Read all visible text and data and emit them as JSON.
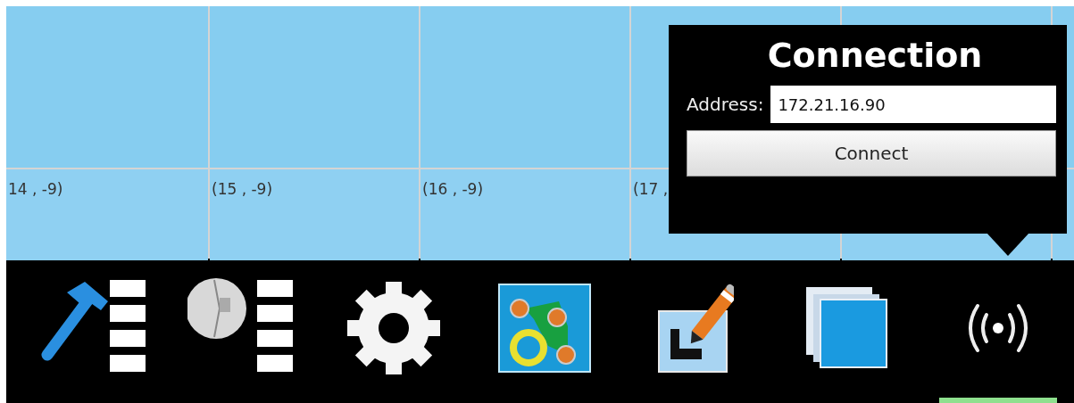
{
  "grid": {
    "labels": [
      "14 , -9)",
      "(15 , -9)",
      "(16 , -9)",
      "(17 ,"
    ]
  },
  "connection_popup": {
    "title": "Connection",
    "address_label": "Address:",
    "address_value": "172.21.16.90",
    "connect_button": "Connect"
  },
  "taskbar": {
    "items": [
      {
        "kind": "tools",
        "selected": false
      },
      {
        "kind": "map",
        "selected": false
      },
      {
        "kind": "settings",
        "selected": false
      },
      {
        "kind": "graph",
        "selected": false
      },
      {
        "kind": "edit",
        "selected": false
      },
      {
        "kind": "layers",
        "selected": false
      },
      {
        "kind": "connection",
        "selected": true
      }
    ]
  }
}
